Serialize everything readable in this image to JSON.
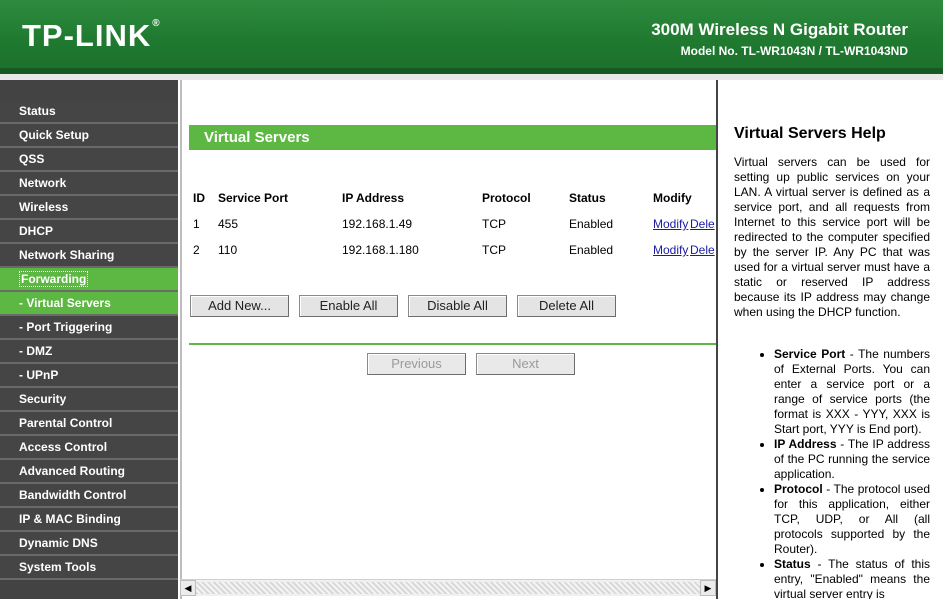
{
  "header": {
    "logo": "TP-LINK",
    "logo_mark": "®",
    "product": "300M Wireless N Gigabit Router",
    "model": "Model No. TL-WR1043N / TL-WR1043ND"
  },
  "sidebar": {
    "items": [
      {
        "label": "Status"
      },
      {
        "label": "Quick Setup"
      },
      {
        "label": "QSS"
      },
      {
        "label": "Network"
      },
      {
        "label": "Wireless"
      },
      {
        "label": "DHCP"
      },
      {
        "label": "Network Sharing"
      },
      {
        "label": "Forwarding"
      },
      {
        "label": "- Virtual Servers"
      },
      {
        "label": "- Port Triggering"
      },
      {
        "label": "- DMZ"
      },
      {
        "label": "- UPnP"
      },
      {
        "label": "Security"
      },
      {
        "label": "Parental Control"
      },
      {
        "label": "Access Control"
      },
      {
        "label": "Advanced Routing"
      },
      {
        "label": "Bandwidth Control"
      },
      {
        "label": "IP & MAC Binding"
      },
      {
        "label": "Dynamic DNS"
      },
      {
        "label": "System Tools"
      }
    ]
  },
  "main": {
    "title": "Virtual Servers",
    "columns": [
      "ID",
      "Service Port",
      "IP Address",
      "Protocol",
      "Status",
      "Modify"
    ],
    "rows": [
      {
        "id": "1",
        "port": "455",
        "ip": "192.168.1.49",
        "protocol": "TCP",
        "status": "Enabled",
        "modify": "Modify",
        "delete": "Dele"
      },
      {
        "id": "2",
        "port": "110",
        "ip": "192.168.1.180",
        "protocol": "TCP",
        "status": "Enabled",
        "modify": "Modify",
        "delete": "Dele"
      }
    ],
    "buttons": {
      "add": "Add New...",
      "enable_all": "Enable All",
      "disable_all": "Disable All",
      "delete_all": "Delete All",
      "previous": "Previous",
      "next": "Next"
    }
  },
  "help": {
    "title": "Virtual Servers Help",
    "intro": "Virtual servers can be used for setting up public services on your LAN. A virtual server is defined as a service port, and all requests from Internet to this service port will be redirected to the computer specified by the server IP. Any PC that was used for a virtual server must have a static or reserved IP address because its IP address may change when using the DHCP function.",
    "items": [
      {
        "term": "Service Port",
        "text": " - The numbers of External Ports. You can enter a service port or a range of service ports (the format is XXX - YYY, XXX is Start port, YYY is End port)."
      },
      {
        "term": "IP Address",
        "text": " - The IP address of the PC running the service application."
      },
      {
        "term": "Protocol",
        "text": " - The protocol used for this application, either TCP, UDP, or All (all protocols supported by the Router)."
      },
      {
        "term": "Status",
        "text": " - The status of this entry, \"Enabled\" means the virtual server entry is"
      }
    ]
  },
  "colors": {
    "brand_green": "#1f7a30",
    "accent_green": "#5db843",
    "sidebar_bg": "#454545"
  }
}
